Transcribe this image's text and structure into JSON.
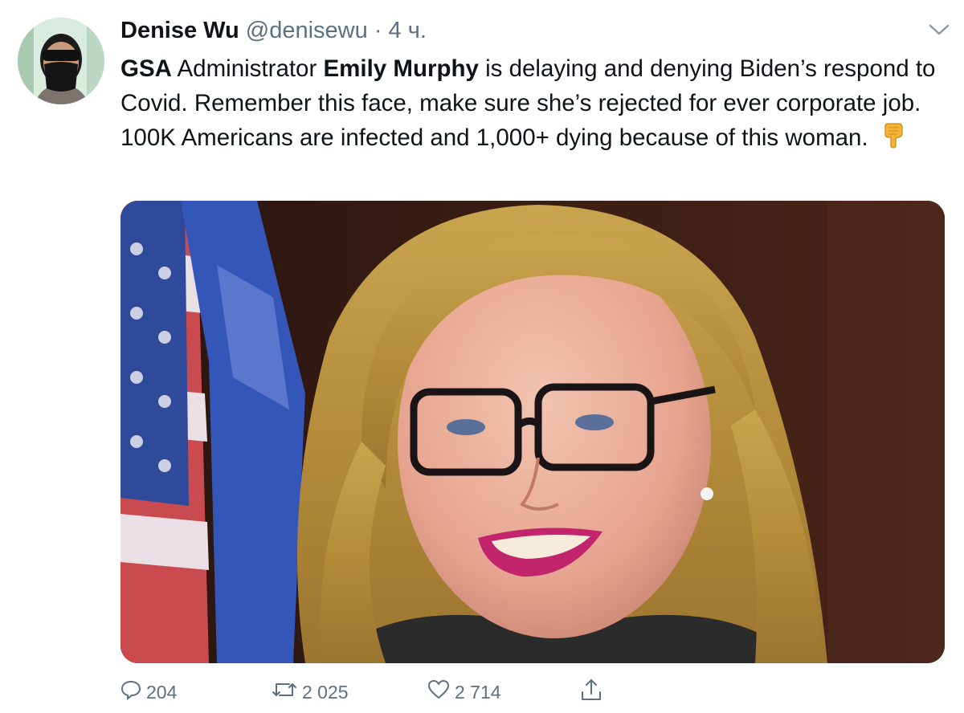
{
  "tweet": {
    "author_name": "Denise Wu",
    "author_handle": "@denisewu",
    "separator": "·",
    "time": "4 ч.",
    "text_part1": "GSA",
    "text_part2": " Administrator ",
    "text_part3": "Emily Murphy",
    "text_part4": " is delaying and denying Biden’s respond to Covid. Remember this face, make sure she’s rejected for ever corporate job. 100K Americans are infected and 1,000+ dying because of this woman.",
    "emoji": "backhand-index-pointing-down"
  },
  "actions": {
    "replies": "204",
    "retweets": "2 025",
    "likes": "2 714"
  },
  "icons": {
    "more": "chevron-down-icon",
    "reply": "comment-icon",
    "retweet": "retweet-icon",
    "like": "heart-icon",
    "share": "share-icon"
  },
  "colors": {
    "text": "#0f1419",
    "secondary": "#5b7083",
    "background": "#ffffff"
  }
}
